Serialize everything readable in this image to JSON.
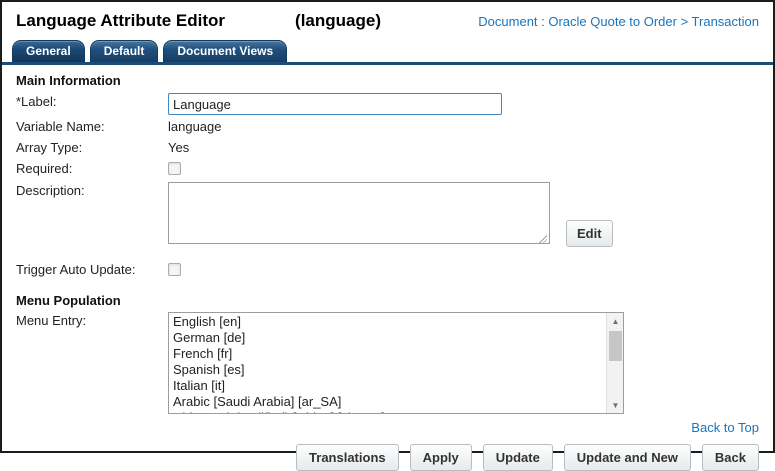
{
  "header": {
    "title": "Language Attribute Editor",
    "subtitle": "(language)",
    "context_link": "Document : Oracle Quote to Order > Transaction"
  },
  "tabs": [
    {
      "label": "General",
      "active": true
    },
    {
      "label": "Default",
      "active": false
    },
    {
      "label": "Document Views",
      "active": false
    }
  ],
  "main_information": {
    "section_title": "Main Information",
    "label_field": {
      "label": "*Label:",
      "value": "Language"
    },
    "variable_name": {
      "label": "Variable Name:",
      "value": "language"
    },
    "array_type": {
      "label": "Array Type:",
      "value": "Yes"
    },
    "required": {
      "label": "Required:",
      "checked": false
    },
    "description": {
      "label": "Description:",
      "value": "",
      "edit_button": "Edit"
    },
    "trigger_auto_update": {
      "label": "Trigger Auto Update:",
      "checked": false
    }
  },
  "menu_population": {
    "section_title": "Menu Population",
    "menu_entry_label": "Menu Entry:",
    "menu_items": [
      "English [en]",
      "German [de]",
      "French [fr]",
      "Spanish [es]",
      "Italian [it]",
      "Arabic [Saudi Arabia] [ar_SA]",
      "Chinese (Simplified) [China] [zh_CN]"
    ]
  },
  "footer": {
    "back_to_top": "Back to Top",
    "buttons": {
      "translations": "Translations",
      "apply": "Apply",
      "update": "Update",
      "update_and_new": "Update and New",
      "back": "Back"
    }
  },
  "colors": {
    "tab_navy": "#1b4c7a",
    "link_blue": "#1b75bc",
    "input_focus_blue": "#3f87c5"
  }
}
